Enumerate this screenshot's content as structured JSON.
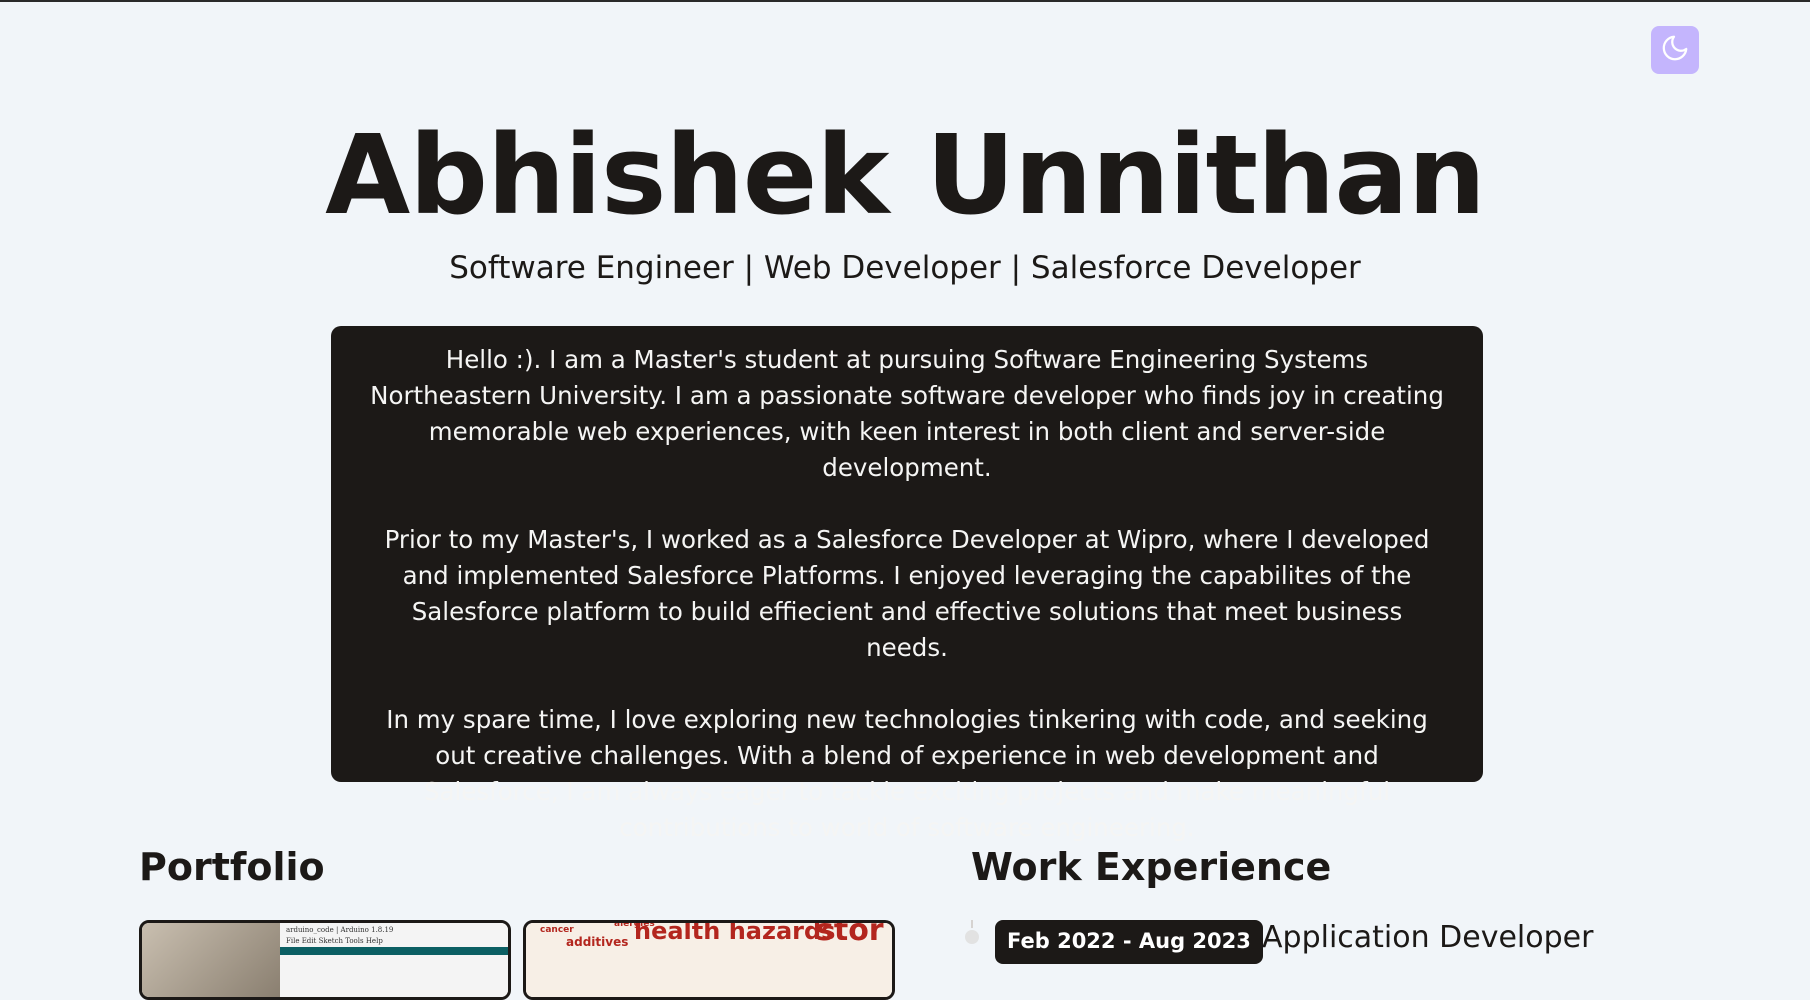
{
  "header": {
    "theme_toggle_icon": "moon-icon"
  },
  "hero": {
    "name": "Abhishek Unnithan",
    "subtitle": "Software Engineer | Web Developer | Salesforce Developer"
  },
  "about": {
    "paragraphs": [
      "Hello :). I am a Master's student at pursuing Software Engineering Systems Northeastern University. I am a passionate software developer who finds joy in creating memorable web experiences, with keen interest in both client and server-side development.",
      "Prior to my Master's, I worked as a Salesforce Developer at Wipro, where I developed and implemented Salesforce Platforms. I enjoyed leveraging the capabilites of the Salesforce platform to build effiecient and effective solutions that meet business needs.",
      "In my spare time, I love exploring new technologies tinkering with code, and seeking out creative challenges. With a blend of experience in web development and Salesforce, I am always eager to tackle exciting projects and make meaningful contributions to world of software engineering."
    ]
  },
  "portfolio": {
    "title": "Portfolio",
    "cards": [
      {
        "mini_window_title": "arduino_code | Arduino 1.8.19",
        "mini_menu": "File Edit Sketch Tools Help"
      },
      {
        "words": [
          "health hazards",
          "stor",
          "additives",
          "alergies",
          "cancer"
        ]
      }
    ]
  },
  "work_experience": {
    "title": "Work Experience",
    "entries": [
      {
        "dates": "Feb 2022 - Aug 2023",
        "role": "Application Developer"
      }
    ]
  },
  "colors": {
    "background": "#f1f5f9",
    "dark_panel": "#1c1917",
    "toggle_accent": "#c4b5fd",
    "toggle_icon": "#ffffff"
  }
}
